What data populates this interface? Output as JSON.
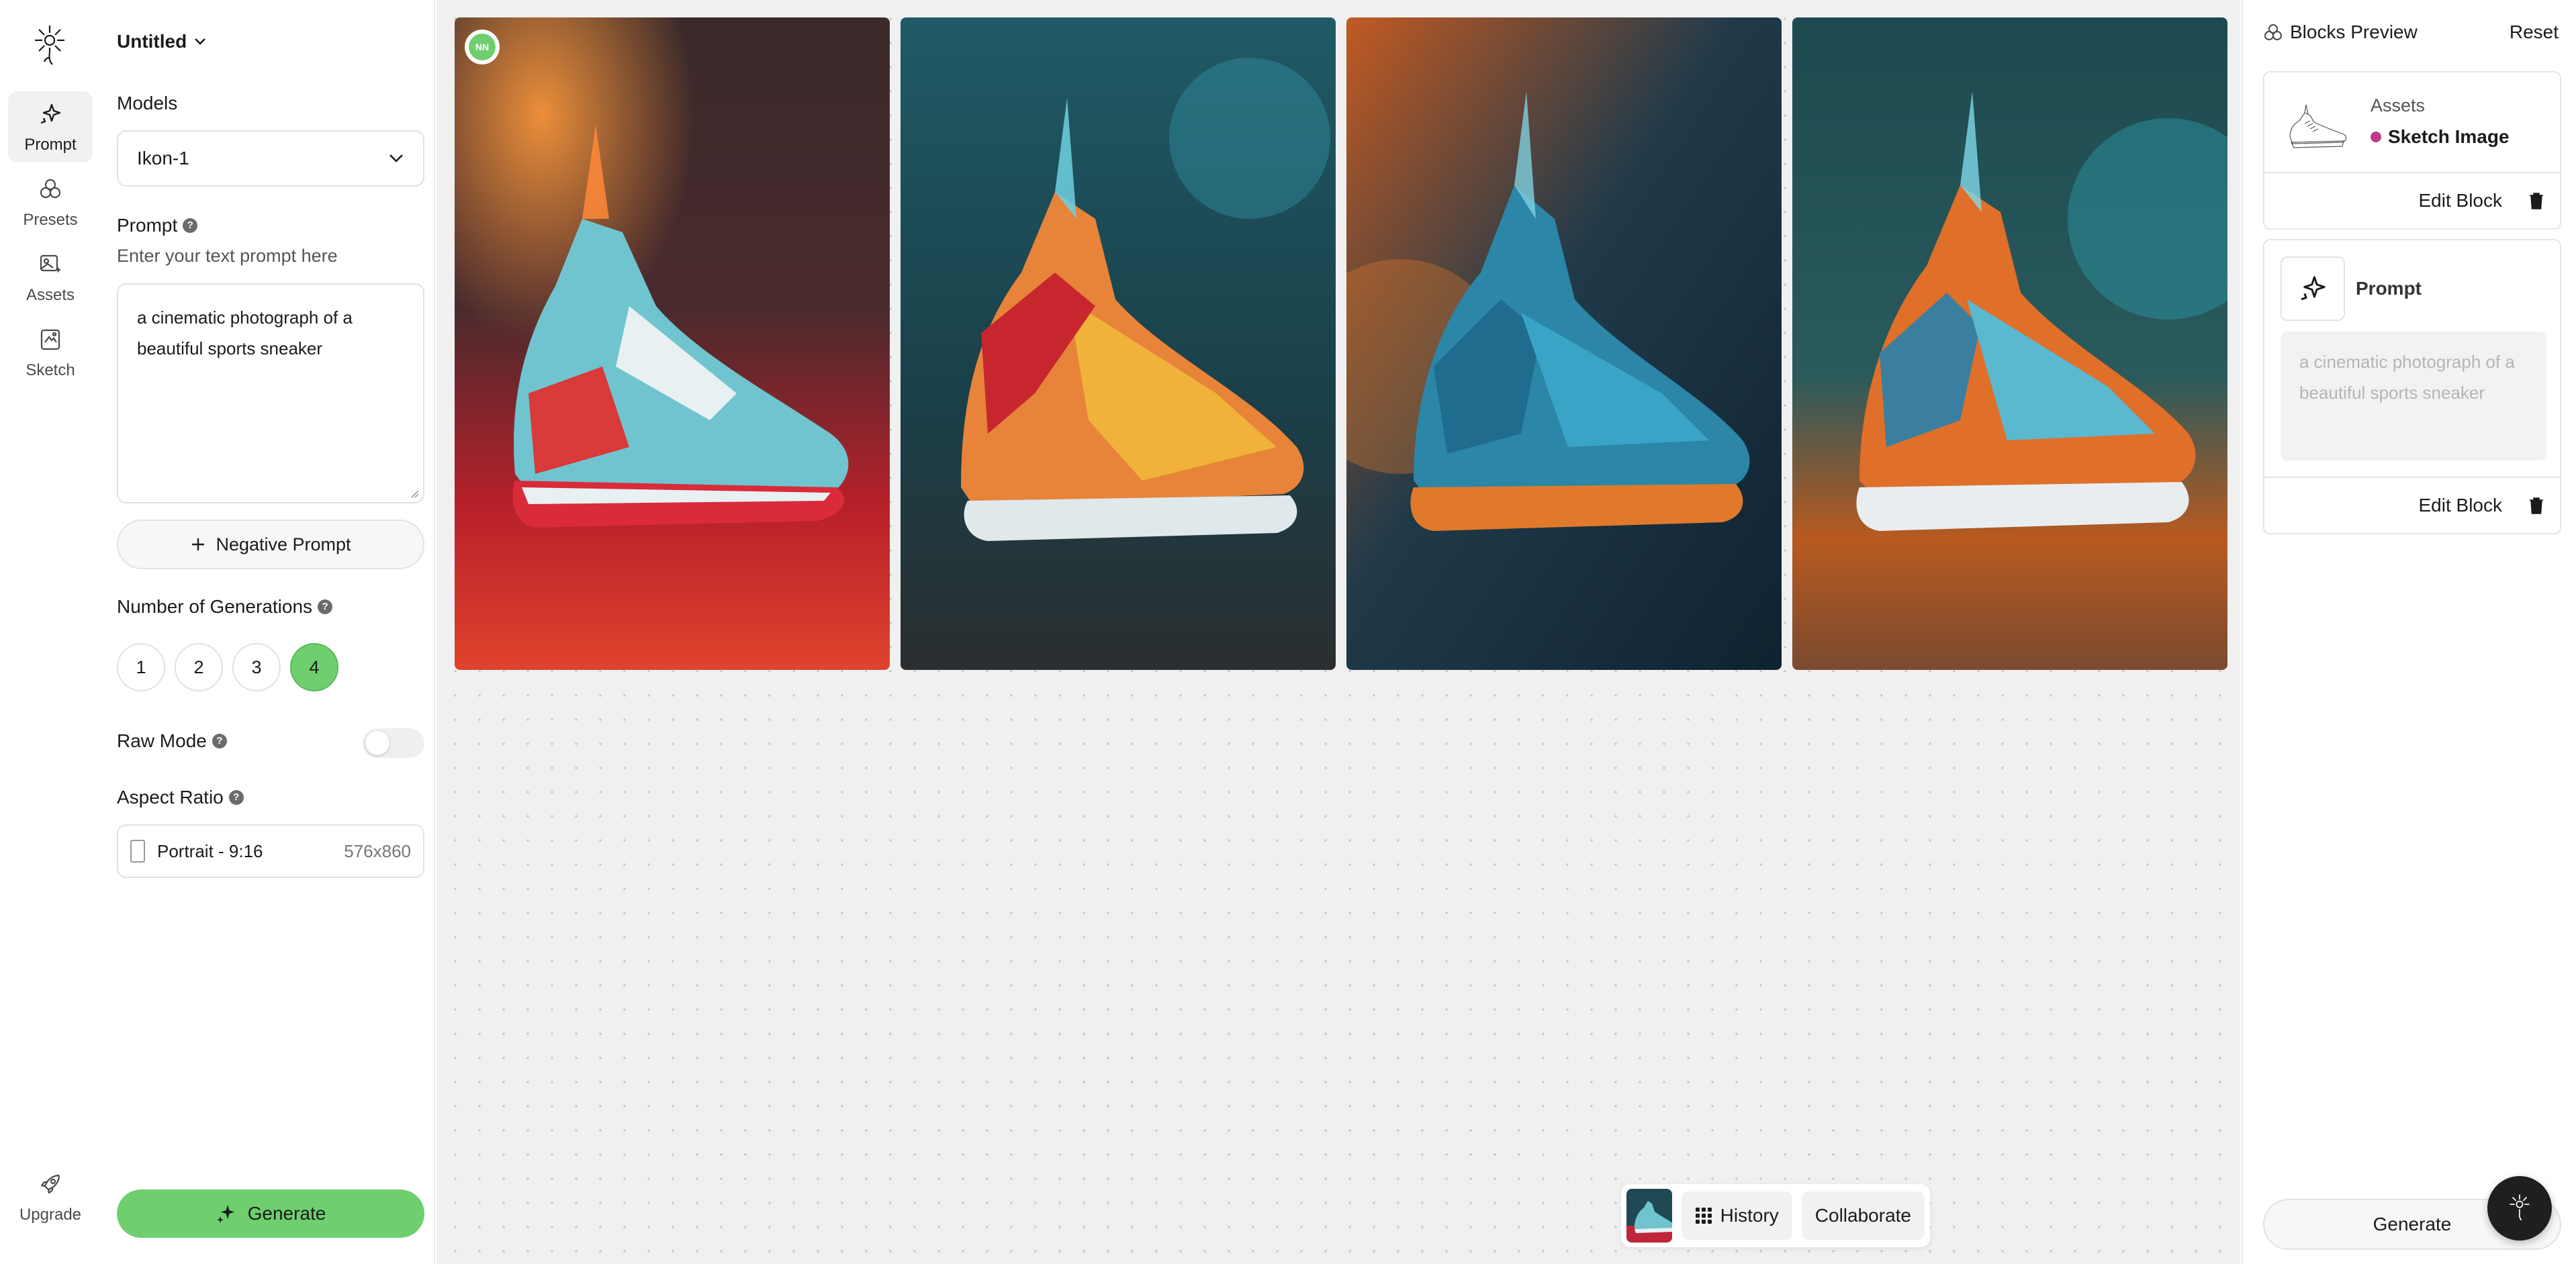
{
  "rail": {
    "items": [
      {
        "label": "Prompt",
        "icon": "prompt-sparkle-icon",
        "active": true
      },
      {
        "label": "Presets",
        "icon": "presets-icon",
        "active": false
      },
      {
        "label": "Assets",
        "icon": "assets-icon",
        "active": false
      },
      {
        "label": "Sketch",
        "icon": "sketch-icon",
        "active": false
      }
    ],
    "upgrade_label": "Upgrade"
  },
  "panel": {
    "project_title": "Untitled",
    "models_label": "Models",
    "model_value": "Ikon-1",
    "prompt_label": "Prompt",
    "prompt_hint": "Enter your text prompt here",
    "prompt_text": "a cinematic photograph of a beautiful sports sneaker",
    "negative_prompt_label": "Negative Prompt",
    "generations_label": "Number of Generations",
    "generation_options": [
      "1",
      "2",
      "3",
      "4"
    ],
    "generation_selected": "4",
    "raw_mode_label": "Raw Mode",
    "raw_mode_on": false,
    "aspect_label": "Aspect Ratio",
    "aspect_value": "Portrait - 9:16",
    "aspect_dimensions": "576x860",
    "generate_label": "Generate"
  },
  "canvas": {
    "avatar_initials": "NN",
    "images": [
      "sneaker-red-teal",
      "sneaker-orange-yellow",
      "sneaker-blue-orange",
      "sneaker-orange-teal"
    ],
    "history_label": "History",
    "collaborate_label": "Collaborate"
  },
  "right_panel": {
    "title": "Blocks Preview",
    "reset_label": "Reset",
    "assets_block": {
      "category": "Assets",
      "name": "Sketch Image",
      "edit_label": "Edit Block"
    },
    "prompt_block": {
      "title": "Prompt",
      "text": "a cinematic photograph of a beautiful sports sneaker",
      "edit_label": "Edit Block"
    },
    "generate_label": "Generate"
  },
  "colors": {
    "accent_green": "#6fcf6f",
    "asset_dot": "#c03a8a",
    "canvas_bg": "#f0f0f0"
  }
}
